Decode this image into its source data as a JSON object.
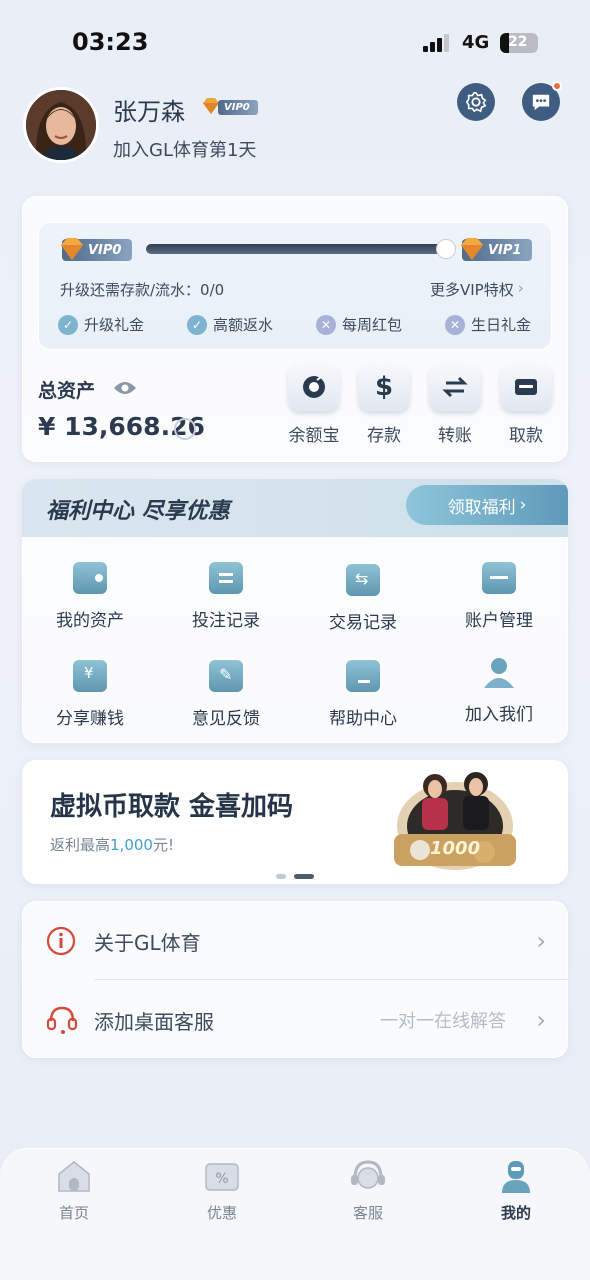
{
  "status_bar": {
    "time": "03:23",
    "network": "4G",
    "battery": "22"
  },
  "profile": {
    "name": "张万森",
    "vip_badge": "VIP0",
    "subtitle": "加入GL体育第1天"
  },
  "vip": {
    "current": "VIP0",
    "next": "VIP1",
    "upgrade_text": "升级还需存款/流水：0/0",
    "more_link": "更多VIP特权",
    "perks": [
      {
        "label": "升级礼金",
        "enabled": true
      },
      {
        "label": "高额返水",
        "enabled": true
      },
      {
        "label": "每周红包",
        "enabled": false
      },
      {
        "label": "生日礼金",
        "enabled": false
      }
    ]
  },
  "assets": {
    "label": "总资产",
    "amount": "¥ 13,668.26"
  },
  "quick_actions": [
    {
      "label": "余额宝",
      "icon": "piggy-icon"
    },
    {
      "label": "存款",
      "icon": "dollar-icon"
    },
    {
      "label": "转账",
      "icon": "transfer-icon"
    },
    {
      "label": "取款",
      "icon": "card-icon"
    }
  ],
  "welfare": {
    "title": "福利中心  尽享优惠",
    "claim_button": "领取福利",
    "items": [
      {
        "label": "我的资产",
        "icon": "wallet-icon"
      },
      {
        "label": "投注记录",
        "icon": "bet-record-icon"
      },
      {
        "label": "交易记录",
        "icon": "transaction-icon"
      },
      {
        "label": "账户管理",
        "icon": "folder-icon"
      },
      {
        "label": "分享赚钱",
        "icon": "share-money-icon"
      },
      {
        "label": "意见反馈",
        "icon": "feedback-icon"
      },
      {
        "label": "帮助中心",
        "icon": "help-icon"
      },
      {
        "label": "加入我们",
        "icon": "join-icon"
      }
    ]
  },
  "banner": {
    "title": "虚拟币取款 金喜加码",
    "sub_prefix": "返利最高",
    "sub_amount": "1,000",
    "sub_suffix": "元!",
    "badge": "1000"
  },
  "menu": [
    {
      "label": "关于GL体育",
      "hint": "",
      "icon": "info-icon"
    },
    {
      "label": "添加桌面客服",
      "hint": "一对一在线解答",
      "icon": "headset-icon"
    }
  ],
  "tabs": [
    {
      "label": "首页",
      "icon": "home-icon",
      "active": false
    },
    {
      "label": "优惠",
      "icon": "discount-icon",
      "active": false
    },
    {
      "label": "客服",
      "icon": "support-icon",
      "active": false
    },
    {
      "label": "我的",
      "icon": "profile-icon",
      "active": true
    }
  ],
  "colors": {
    "accent": "#5e9ab9",
    "dark": "#2c3a4f",
    "notify": "#ef6b3a"
  }
}
